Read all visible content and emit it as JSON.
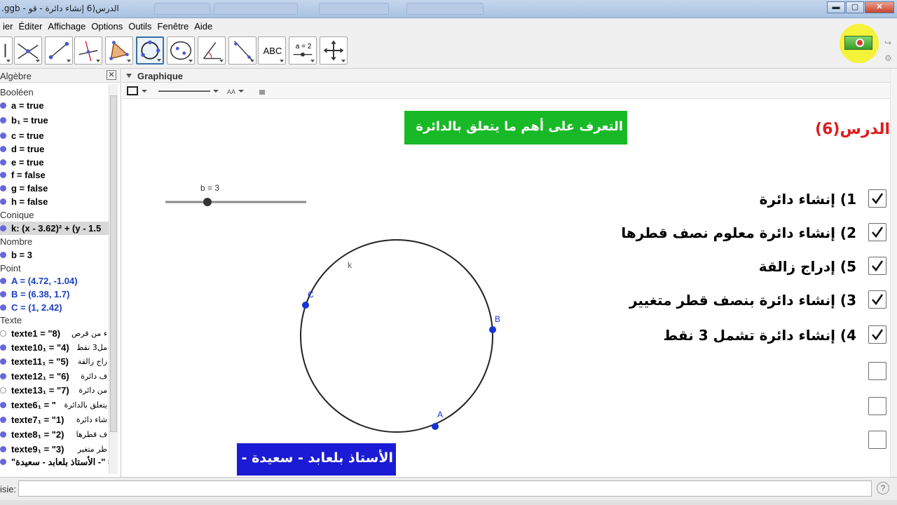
{
  "window": {
    "title": ".ggb - الدرس(6 إنشاء دائرة - قو",
    "blurred_tabs": [
      "",
      "",
      "",
      ""
    ],
    "min_label": "▬",
    "max_label": "▢",
    "close_label": "✕"
  },
  "menu": [
    "ier",
    "Éditer",
    "Affichage",
    "Options",
    "Outils",
    "Fenêtre",
    "Aide"
  ],
  "algebra": {
    "title": "Algèbre",
    "close_label": "✕",
    "rows": [
      {
        "type": "cat",
        "text": "Booléen"
      },
      {
        "type": "item",
        "text": "a = true"
      },
      {
        "type": "item",
        "text": "b₁ = true"
      },
      {
        "type": "item",
        "text": "c = true"
      },
      {
        "type": "item",
        "text": "d = true"
      },
      {
        "type": "item",
        "text": "e = true"
      },
      {
        "type": "item",
        "text": "f = false"
      },
      {
        "type": "item",
        "text": "g = false"
      },
      {
        "type": "item",
        "text": "h = false"
      },
      {
        "type": "cat",
        "text": "Conique"
      },
      {
        "type": "item",
        "text": "k: (x - 3.62)² + (y - 1.5",
        "highlight": true
      },
      {
        "type": "cat",
        "text": "Nombre"
      },
      {
        "type": "item",
        "text": "b = 3"
      },
      {
        "type": "cat",
        "text": "Point"
      },
      {
        "type": "item",
        "text": "A = (4.72, -1.04)",
        "blue": true
      },
      {
        "type": "item",
        "text": "B = (6.38, 1.7)",
        "blue": true
      },
      {
        "type": "item",
        "text": "C = (1, 2.42)",
        "blue": true
      },
      {
        "type": "cat",
        "text": "Texte"
      },
      {
        "type": "text",
        "text": "texte1 = \"8)",
        "ar": "ء من قرص",
        "hollow": true
      },
      {
        "type": "text",
        "text": "texte10₁ = \"4)",
        "ar": "مل3 نقط"
      },
      {
        "type": "text",
        "text": "texte11₁ = \"5)",
        "ar": "راج زالقة"
      },
      {
        "type": "text",
        "text": "texte12₁ = \"6)",
        "ar": "ف دائرة"
      },
      {
        "type": "text",
        "text": "texte13₁ = \"7)",
        "ar": "من دائرة",
        "hollow": true
      },
      {
        "type": "text",
        "text": "texte6₁ = \"",
        "ar": "يتعلق بالدائرة"
      },
      {
        "type": "text",
        "text": "texte7₁ = \"1)",
        "ar": "شاء دائرة"
      },
      {
        "type": "text",
        "text": "texte8₁ = \"2)",
        "ar": "ف قطرها"
      },
      {
        "type": "text",
        "text": "texte9₁ = \"3)",
        "ar": "طر متغير"
      },
      {
        "type": "text",
        "text": "\"الأستاذ بلعابد - سعيدة -\" =",
        "ar": ""
      }
    ]
  },
  "graphics": {
    "title": "Graphique",
    "slider_label": "b = 3",
    "title_box": "التعرف على أهم ما يتعلق بالدائرة",
    "lesson": "الدرس(6)",
    "circle_label": "k",
    "points": [
      {
        "name": "A",
        "label": "A"
      },
      {
        "name": "B",
        "label": "B"
      },
      {
        "name": "C",
        "label": "C"
      }
    ],
    "items": [
      {
        "label": "1) إنشاء دائرة",
        "checked": true
      },
      {
        "label": "2) إنشاء دائرة معلوم نصف قطرها",
        "checked": true
      },
      {
        "label": "5) إدراج زالقة",
        "checked": true
      },
      {
        "label": "3) إنشاء دائرة بنصف قطر متغيير",
        "checked": true
      },
      {
        "label": "4) إنشاء دائرة تشمل 3 نقط",
        "checked": true
      },
      {
        "label": "",
        "checked": false
      },
      {
        "label": "",
        "checked": false
      },
      {
        "label": "",
        "checked": false
      }
    ],
    "teacher": "الأستاذ بلعابد - سعيدة -"
  },
  "toolbar": {
    "tools": [
      "move-tool",
      "intersect-tool",
      "segment-tool",
      "perpendicular-tool",
      "polygon-tool",
      "circle-3points-tool",
      "circle-tool",
      "angle-tool",
      "reflect-tool",
      "text-tool",
      "slider-tool",
      "move-graphics-tool"
    ],
    "text_tool_label": "ABC",
    "slider_tool_label": "a = 2"
  },
  "inputbar": {
    "label": "isie:",
    "value": "",
    "help": "?"
  }
}
